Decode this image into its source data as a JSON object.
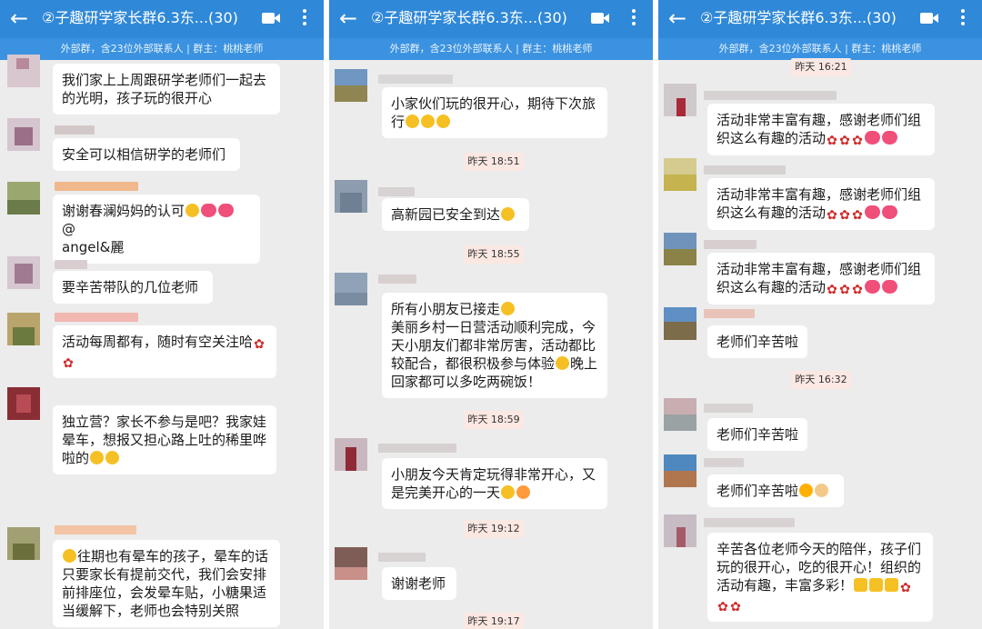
{
  "chat": {
    "title": "②子趣研学家长群6.3东...(30)",
    "subtitle": "外部群，含23位外部联系人 | 群主：桃桃老师",
    "back_icon": "back-arrow-icon",
    "video_icon": "video-call-icon",
    "more_icon": "more-vertical-icon"
  },
  "colors": {
    "header": "#2f88d8",
    "subheader": "#3a92e0",
    "background": "#ececec",
    "timestamp_bg": "#fbe8e3"
  },
  "panels": [
    {
      "messages": [
        {
          "lines": [
            "我们家上上周跟研学老师们一起去",
            "的光明，孩子玩的很开心"
          ]
        },
        {
          "lines": [
            "安全可以相信研学的老师们"
          ]
        },
        {
          "lines": [
            "谢谢春澜妈妈的认可",
            "angel&麗"
          ],
          "emojis": [
            "worry",
            "heart",
            "heart"
          ]
        },
        {
          "lines": [
            "要辛苦带队的几位老师"
          ]
        },
        {
          "lines": [
            "活动每周都有，随时有空关注哈"
          ],
          "emojis": [
            "rose",
            "rose"
          ]
        },
        {
          "lines": [
            "独立营？家长不参与是吧？我家娃",
            "晕车，想报又担心路上吐的稀里哗",
            "啦的"
          ],
          "emojis": [
            "face",
            "face"
          ]
        },
        {
          "lines": [
            "往期也有晕车的孩子，晕车的话",
            "只要家长有提前交代，我们会安排",
            "前排座位，会发晕车贴，小糖果适",
            "当缓解下，老师也会特别关照"
          ],
          "emojis": [
            "worry"
          ]
        }
      ]
    },
    {
      "messages": [
        {
          "lines": [
            "小家伙们玩的很开心，期待下次旅",
            "行"
          ],
          "emojis": [
            "face",
            "face",
            "face"
          ]
        },
        {
          "lines": [
            "高新园已安全到达"
          ],
          "emojis": [
            "face"
          ]
        },
        {
          "lines": [
            "所有小朋友已接走",
            "美丽乡村一日营活动顺利完成，今",
            "天小朋友们都非常厉害，活动都比",
            "较配合，都很积极参与体验",
            "回家都可以多吃两碗饭！"
          ],
          "emojis": [
            "face",
            "worry"
          ],
          "tail": "晚上"
        },
        {
          "lines": [
            "小朋友今天肯定玩得非常开心，又",
            "是完美开心的一天"
          ],
          "emojis": [
            "v",
            "party"
          ]
        },
        {
          "lines": [
            "谢谢老师"
          ]
        }
      ],
      "timestamps": [
        "昨天 18:51",
        "昨天 18:55",
        "昨天 18:59",
        "昨天 19:12",
        "昨天 19:17"
      ]
    },
    {
      "messages": [
        {
          "lines": [
            "活动非常丰富有趣，感谢老师们组",
            "织这么有趣的活动"
          ],
          "emojis": [
            "rose",
            "rose",
            "rose",
            "heart",
            "heart"
          ]
        },
        {
          "lines": [
            "活动非常丰富有趣，感谢老师们组",
            "织这么有趣的活动"
          ],
          "emojis": [
            "rose",
            "rose",
            "rose",
            "heart",
            "heart"
          ]
        },
        {
          "lines": [
            "活动非常丰富有趣，感谢老师们组",
            "织这么有趣的活动"
          ],
          "emojis": [
            "rose",
            "rose",
            "rose",
            "heart",
            "heart"
          ]
        },
        {
          "lines": [
            "老师们辛苦啦"
          ]
        },
        {
          "lines": [
            "老师们辛苦啦"
          ]
        },
        {
          "lines": [
            "老师们辛苦啦"
          ],
          "emojis": [
            "sun",
            "pray"
          ]
        },
        {
          "lines": [
            "辛苦各位老师今天的陪伴，孩子们",
            "玩的很开心，吃的很开心！组织的",
            "活动有趣，丰富多彩！"
          ],
          "emojis": [
            "thumb",
            "thumb",
            "thumb",
            "rose",
            "rose",
            "rose"
          ]
        }
      ],
      "timestamps": [
        "昨天 16:21",
        "昨天 16:32"
      ]
    }
  ]
}
